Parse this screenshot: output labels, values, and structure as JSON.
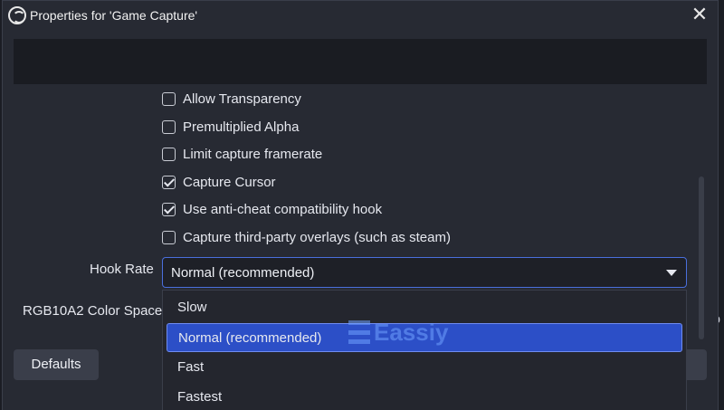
{
  "window": {
    "title": "Properties for 'Game Capture'"
  },
  "checkboxes": [
    {
      "label": "Allow Transparency",
      "checked": false
    },
    {
      "label": "Premultiplied Alpha",
      "checked": false
    },
    {
      "label": "Limit capture framerate",
      "checked": false
    },
    {
      "label": "Capture Cursor",
      "checked": true
    },
    {
      "label": "Use anti-cheat compatibility hook",
      "checked": true
    },
    {
      "label": "Capture third-party overlays (such as steam)",
      "checked": false
    }
  ],
  "hook_rate": {
    "label": "Hook Rate",
    "value": "Normal (recommended)",
    "options": [
      "Slow",
      "Normal (recommended)",
      "Fast",
      "Fastest"
    ],
    "selected_index": 1
  },
  "color_space": {
    "label": "RGB10A2 Color Space"
  },
  "buttons": {
    "defaults": "Defaults"
  },
  "watermark": {
    "text": "Eassiy"
  },
  "colors": {
    "accent": "#2c4fc7",
    "dialog_bg": "#272a33",
    "field_bg": "#1e2027"
  }
}
